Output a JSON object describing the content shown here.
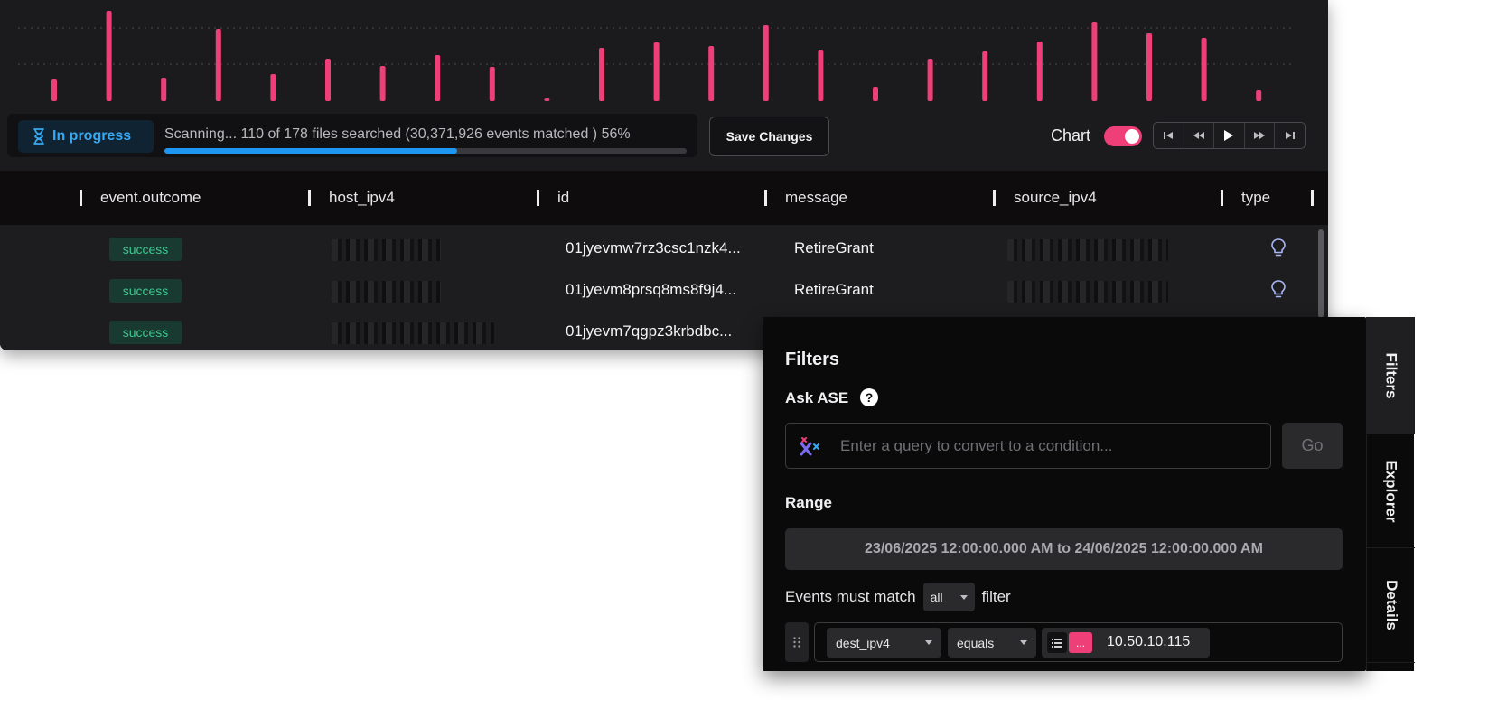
{
  "histogram": {
    "bar_color": "#ee3f78",
    "max": 100,
    "values": [
      24,
      100,
      26,
      80,
      30,
      47,
      39,
      51,
      38,
      3,
      59,
      65,
      61,
      84,
      57,
      16,
      47,
      55,
      66,
      88,
      75,
      70,
      12
    ]
  },
  "status": {
    "badge_label": "In progress",
    "scan_text": "Scanning... 110 of 178 files searched (30,371,926 events matched ) 56%",
    "progress_fraction": 0.56
  },
  "toolbar": {
    "save_label": "Save Changes",
    "chart_label": "Chart",
    "chart_toggle_on": true,
    "playback": [
      "first",
      "rewind",
      "play",
      "fast-forward",
      "last"
    ]
  },
  "table": {
    "columns": [
      "event.outcome",
      "host_ipv4",
      "id",
      "message",
      "source_ipv4",
      "type"
    ],
    "rows": [
      {
        "outcome": "success",
        "id": "01jyevmw7rz3csc1nzk4...",
        "message": "RetireGrant",
        "type_icon": "lightbulb-icon"
      },
      {
        "outcome": "success",
        "id": "01jyevm8prsq8ms8f9j4...",
        "message": "RetireGrant",
        "type_icon": "lightbulb-icon"
      },
      {
        "outcome": "success",
        "id": "01jyevm7qgpz3krbdbc...",
        "message": "",
        "type_icon": ""
      }
    ]
  },
  "filters": {
    "title": "Filters",
    "ask_label": "Ask ASE",
    "ask_placeholder": "Enter a query to convert to a condition...",
    "go_label": "Go",
    "range_label": "Range",
    "range_value": "23/06/2025 12:00:00.000 AM to 24/06/2025 12:00:00.000 AM",
    "match_prefix": "Events must match",
    "match_value": "all",
    "match_suffix": "filter",
    "condition": {
      "field": "dest_ipv4",
      "operator": "equals",
      "more_label": "...",
      "value": "10.50.10.115"
    }
  },
  "side_tabs": [
    "Filters",
    "Explorer",
    "Details"
  ],
  "colors": {
    "accent": "#ee3f78",
    "progress": "#1d97f2",
    "success": "#3cc790"
  }
}
